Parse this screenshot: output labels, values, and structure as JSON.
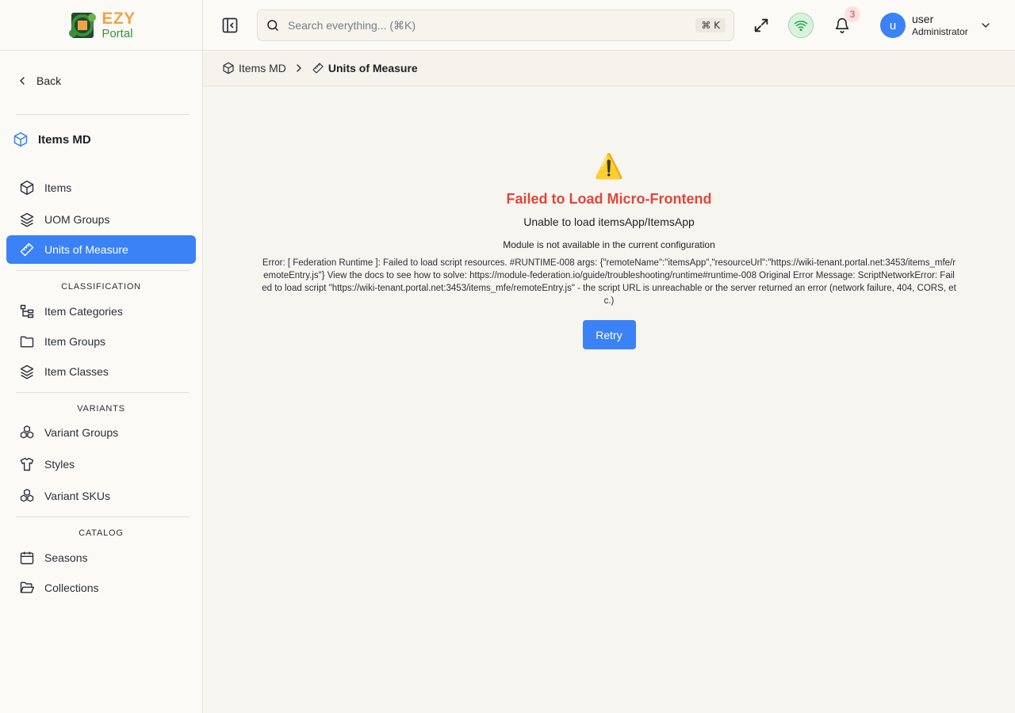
{
  "logo": {
    "brand_top": "EZY",
    "brand_bottom": "Portal"
  },
  "sidebar": {
    "back_label": "Back",
    "module_title": "Items MD",
    "items": [
      {
        "label": "Items",
        "icon": "box-icon"
      },
      {
        "label": "UOM Groups",
        "icon": "layers-icon"
      },
      {
        "label": "Units of Measure",
        "icon": "ruler-icon",
        "active": true
      }
    ],
    "sections": [
      {
        "title": "CLASSIFICATION",
        "items": [
          {
            "label": "Item Categories",
            "icon": "tree-icon"
          },
          {
            "label": "Item Groups",
            "icon": "folder-icon"
          },
          {
            "label": "Item Classes",
            "icon": "layers-icon"
          }
        ]
      },
      {
        "title": "VARIANTS",
        "items": [
          {
            "label": "Variant Groups",
            "icon": "boxes-icon"
          },
          {
            "label": "Styles",
            "icon": "shirt-icon"
          },
          {
            "label": "Variant SKUs",
            "icon": "boxes-icon"
          }
        ]
      },
      {
        "title": "CATALOG",
        "items": [
          {
            "label": "Seasons",
            "icon": "calendar-icon"
          },
          {
            "label": "Collections",
            "icon": "folder-open-icon"
          }
        ]
      }
    ]
  },
  "header": {
    "search_placeholder": "Search everything... (⌘K)",
    "shortcut": "⌘ K",
    "notification_count": "3",
    "user_initial": "u",
    "user_name": "user",
    "user_role": "Administrator"
  },
  "breadcrumb": {
    "items": [
      "Items MD",
      "Units of Measure"
    ]
  },
  "error": {
    "icon": "⚠️",
    "title": "Failed to Load Micro-Frontend",
    "subtitle": "Unable to load itemsApp/ItemsApp",
    "module_message": "Module is not available in the current configuration",
    "detail": "Error: [ Federation Runtime ]: Failed to load script resources. #RUNTIME-008 args: {\"remoteName\":\"itemsApp\",\"resourceUrl\":\"https://wiki-tenant.portal.net:3453/items_mfe/remoteEntry.js\"} View the docs to see how to solve: https://module-federation.io/guide/troubleshooting/runtime#runtime-008 Original Error Message: ScriptNetworkError: Failed to load script \"https://wiki-tenant.portal.net:3453/items_mfe/remoteEntry.js\" - the script URL is unreachable or the server returned an error (network failure, 404, CORS, etc.)",
    "retry_label": "Retry"
  },
  "colors": {
    "accent": "#3b82f6",
    "error": "#e0453f",
    "background": "#f7f5ef"
  }
}
